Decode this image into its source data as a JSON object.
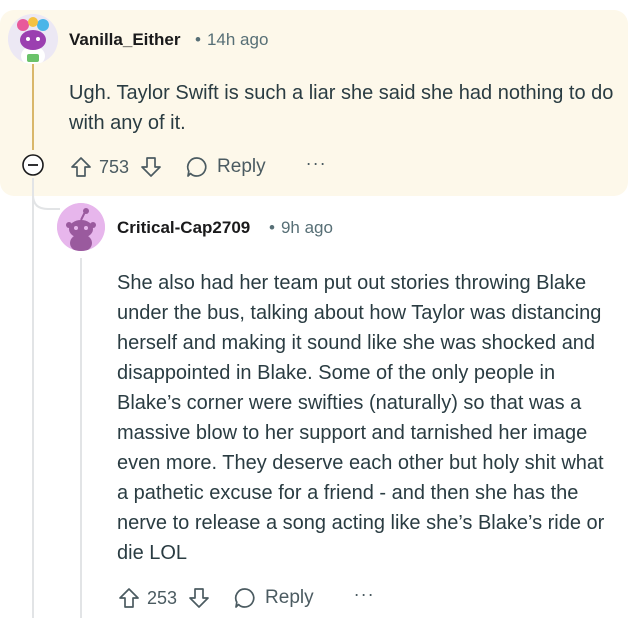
{
  "comments": [
    {
      "author": "Vanilla_Either",
      "time": "14h ago",
      "body": "Ugh. Taylor Swift is such a liar she said she had nothing to do with any of it.",
      "score": "753",
      "reply_label": "Reply",
      "more_label": "···",
      "highlighted": true
    },
    {
      "author": "Critical-Cap2709",
      "time": "9h ago",
      "body": "She also had her team put out stories throwing Blake under the bus, talking about how Taylor was distancing herself and making it sound like she was shocked and disappointed in Blake. Some of the only people in Blake’s corner were swifties (naturally) so that was a massive blow to her support and tarnished her image even more. They deserve each other but holy shit what a pathetic excuse for a friend - and then she has the nerve to release a song acting like she’s Blake’s ride or die LOL",
      "score": "253",
      "reply_label": "Reply",
      "more_label": "···"
    }
  ],
  "meta_separator": "•",
  "icons": {
    "upvote": "upvote-icon",
    "downvote": "downvote-icon",
    "reply": "reply-bubble-icon",
    "collapse": "collapse-minus-icon"
  },
  "colors": {
    "highlight_bg": "#fdf8ea",
    "thread_line_gold": "#d9b76a",
    "thread_line": "#e2e4e6",
    "text_meta": "#576f76",
    "body_text": "#2a3c42"
  }
}
